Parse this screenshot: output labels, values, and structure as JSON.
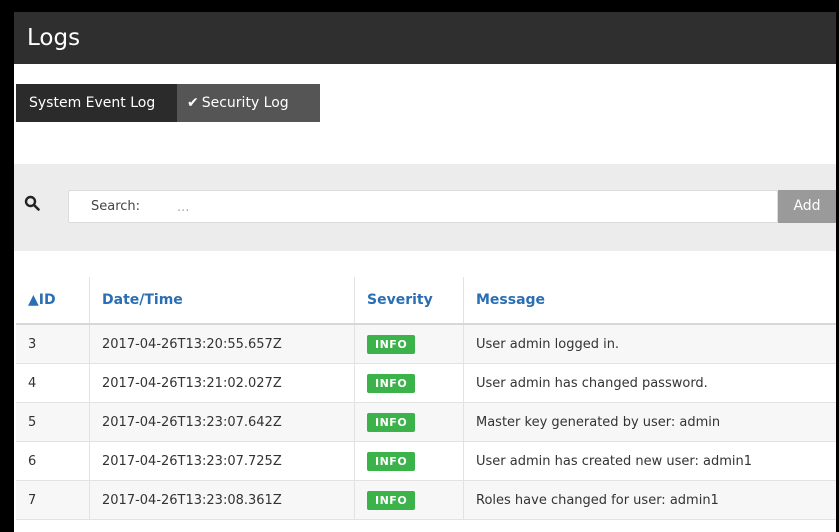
{
  "window": {
    "title": "Logs"
  },
  "tabs": [
    {
      "label": "System Event Log",
      "active": false
    },
    {
      "label": "Security Log",
      "active": true,
      "icon": "check-icon"
    }
  ],
  "search": {
    "label": "Search:",
    "placeholder": "...",
    "add_label": "Add"
  },
  "table": {
    "columns": {
      "id": "▲ID",
      "datetime": "Date/Time",
      "severity": "Severity",
      "message": "Message"
    },
    "rows": [
      {
        "id": "3",
        "datetime": "2017-04-26T13:20:55.657Z",
        "severity": "INFO",
        "message": "User admin logged in."
      },
      {
        "id": "4",
        "datetime": "2017-04-26T13:21:02.027Z",
        "severity": "INFO",
        "message": "User admin has changed password."
      },
      {
        "id": "5",
        "datetime": "2017-04-26T13:23:07.642Z",
        "severity": "INFO",
        "message": "Master key generated by user: admin"
      },
      {
        "id": "6",
        "datetime": "2017-04-26T13:23:07.725Z",
        "severity": "INFO",
        "message": "User admin has created new user: admin1"
      },
      {
        "id": "7",
        "datetime": "2017-04-26T13:23:08.361Z",
        "severity": "INFO",
        "message": "Roles have changed for user: admin1"
      }
    ]
  },
  "colors": {
    "header_bg": "#2f2f2f",
    "accent": "#2a6fb3",
    "info_badge": "#3bb34a"
  }
}
